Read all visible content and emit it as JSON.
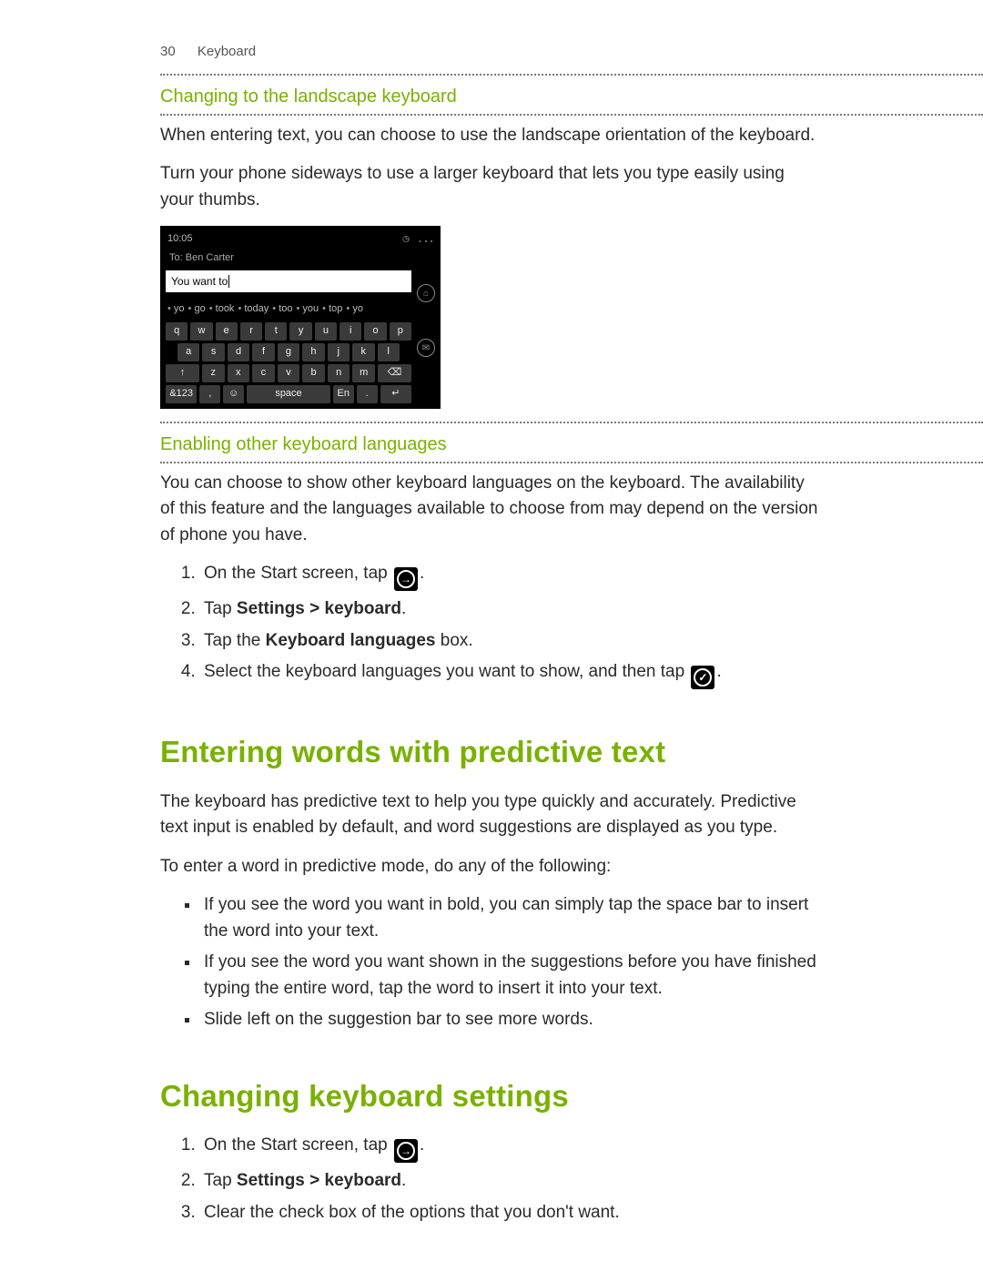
{
  "header": {
    "page_number": "30",
    "section": "Keyboard"
  },
  "s1": {
    "title": "Changing to the landscape keyboard",
    "p1": "When entering text, you can choose to use the landscape orientation of the keyboard.",
    "p2": "Turn your phone sideways to use a larger keyboard that lets you type easily using your thumbs."
  },
  "phone": {
    "time": "10:05",
    "to_label": "To:",
    "to_value": "Ben Carter",
    "input_text": "You want to",
    "suggestions": [
      "yo",
      "go",
      "took",
      "today",
      "too",
      "you",
      "top",
      "yo"
    ],
    "rows": [
      [
        "q",
        "w",
        "e",
        "r",
        "t",
        "y",
        "u",
        "i",
        "o",
        "p"
      ],
      [
        "a",
        "s",
        "d",
        "f",
        "g",
        "h",
        "j",
        "k",
        "l"
      ],
      [
        "↑",
        "z",
        "x",
        "c",
        "v",
        "b",
        "n",
        "m",
        "⌫"
      ],
      [
        "&123",
        ",",
        "☺",
        "space",
        "En",
        ".",
        "↵"
      ]
    ]
  },
  "s2": {
    "title": "Enabling other keyboard languages",
    "p1": "You can choose to show other keyboard languages on the keyboard. The availability of this feature and the languages available to choose from may depend on the version of phone you have.",
    "steps": {
      "s1_pre": "On the Start screen, tap ",
      "s1_post": ".",
      "s2_pre": "Tap ",
      "s2_bold": "Settings > keyboard",
      "s2_post": ".",
      "s3_pre": "Tap the ",
      "s3_bold": "Keyboard languages",
      "s3_post": " box.",
      "s4_pre": "Select the keyboard languages you want to show, and then tap ",
      "s4_post": "."
    }
  },
  "s3": {
    "title": "Entering words with predictive text",
    "p1": "The keyboard has predictive text to help you type quickly and accurately. Predictive text input is enabled by default, and word suggestions are displayed as you type.",
    "p2": "To enter a word in predictive mode, do any of the following:",
    "bullets": [
      "If you see the word you want in bold, you can simply tap the space bar to insert the word into your text.",
      "If you see the word you want shown in the suggestions before you have finished typing the entire word, tap the word to insert it into your text.",
      "Slide left on the suggestion bar to see more words."
    ]
  },
  "s4": {
    "title": "Changing keyboard settings",
    "steps": {
      "s1_pre": "On the Start screen, tap ",
      "s1_post": ".",
      "s2_pre": "Tap ",
      "s2_bold": "Settings > keyboard",
      "s2_post": ".",
      "s3": "Clear the check box of the options that you don't want."
    }
  }
}
